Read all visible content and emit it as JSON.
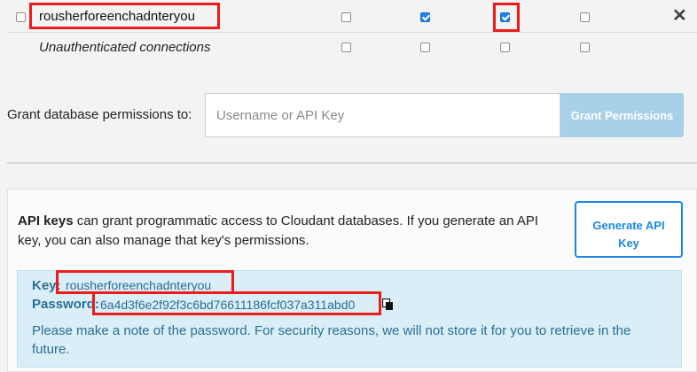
{
  "permissions": {
    "rows": [
      {
        "name": "rousherforeenchadnteryou",
        "italic": false,
        "checks": [
          false,
          false,
          true,
          true,
          false
        ],
        "removable": true
      },
      {
        "name": "Unauthenticated connections",
        "italic": true,
        "checks": [
          false,
          false,
          false,
          false,
          false
        ],
        "removable": false
      }
    ],
    "remove_icon": "close-icon",
    "remove_glyph": "✕"
  },
  "grant": {
    "label": "Grant database permissions to:",
    "placeholder": "Username or API Key",
    "value": "",
    "button_label": "Grant Permissions"
  },
  "api": {
    "lead_bold": "API keys",
    "lead_text": " can grant programmatic access to Cloudant databases. If you generate an API key, you can also manage that key's permissions.",
    "generate_button_line1": "Generate API",
    "generate_button_line2": "Key",
    "key_label": "Key:",
    "key_value": "rousherforeenchadnteryou",
    "password_label": "Password:",
    "password_value": "6a4d3f6e2f92f3c6bd76611186fcf037a311abd0",
    "copy_icon": "copy-icon",
    "note": "Please make a note of the password. For security reasons, we will not store it for you to retrieve in the future."
  },
  "colors": {
    "accent": "#1c86e8",
    "highlight_box": "#ee1b1b",
    "info_bg": "#d9eef7",
    "info_text": "#2b6f95",
    "disabled_button": "#a8d0e6"
  }
}
